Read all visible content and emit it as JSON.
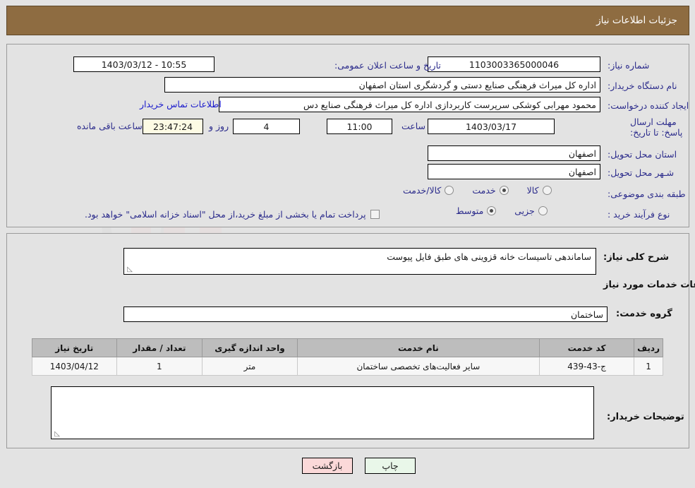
{
  "header": {
    "title": "جزئیات اطلاعات نیاز"
  },
  "form": {
    "need_number_label": "شماره نیاز:",
    "need_number_value": "1103003365000046",
    "announce_label": "تاریخ و ساعت اعلان عمومی:",
    "announce_value": "10:55 - 1403/03/12",
    "buyer_org_label": "نام دستگاه خریدار:",
    "buyer_org_value": "اداره کل میراث فرهنگی  صنایع دستی و گردشگری استان اصفهان",
    "creator_label": "ایجاد کننده درخواست:",
    "creator_value": "محمود مهرابی کوشکی سرپرست کاربردازی اداره کل میراث فرهنگی  صنایع دس",
    "contact_link": "اطلاعات تماس خریدار",
    "deadline_label": "مهلت ارسال پاسخ: تا تاریخ:",
    "deadline_date": "1403/03/17",
    "hour_label": "ساعت",
    "deadline_time": "11:00",
    "days_value": "4",
    "days_label": "روز و",
    "countdown_value": "23:47:24",
    "countdown_label": "ساعت باقی مانده",
    "province_label": "استان محل تحویل:",
    "province_value": "اصفهان",
    "city_label": "شـهر محل تحویل:",
    "city_value": "اصفهان",
    "category_label": "طبقه بندی موضوعی:",
    "category_options": [
      "کالا",
      "خدمت",
      "کالا/خدمت"
    ],
    "category_selected": "خدمت",
    "process_label": "نوع فرآیند خرید :",
    "process_options": [
      "جزیی",
      "متوسط"
    ],
    "process_selected": "متوسط",
    "treasury_checkbox_text": "پرداخت تمام یا بخشی از مبلغ خرید،از محل \"اسناد خزانه اسلامی\" خواهد بود.",
    "treasury_checked": false
  },
  "need_description": {
    "label": "شرح کلی نیاز:",
    "value": "ساماندهی تاسیسات خانه قزوینی های طبق فایل پیوست"
  },
  "services": {
    "section_title": "اطلاعات خدمات مورد نیاز",
    "group_label": "گروه خدمت:",
    "group_value": "ساختمان",
    "columns": [
      "ردیف",
      "کد خدمت",
      "نام خدمت",
      "واحد اندازه گیری",
      "تعداد / مقدار",
      "تاریخ نیاز"
    ],
    "rows": [
      {
        "index": "1",
        "code": "ج-43-439",
        "name": "سایر فعالیت‌های تخصصی ساختمان",
        "unit": "متر",
        "quantity": "1",
        "need_date": "1403/04/12"
      }
    ]
  },
  "buyer_notes": {
    "label": "توضیحات خریدار:",
    "value": ""
  },
  "buttons": {
    "print": "چاپ",
    "back": "بازگشت"
  },
  "watermark": {
    "text": "AnaTender.net"
  }
}
